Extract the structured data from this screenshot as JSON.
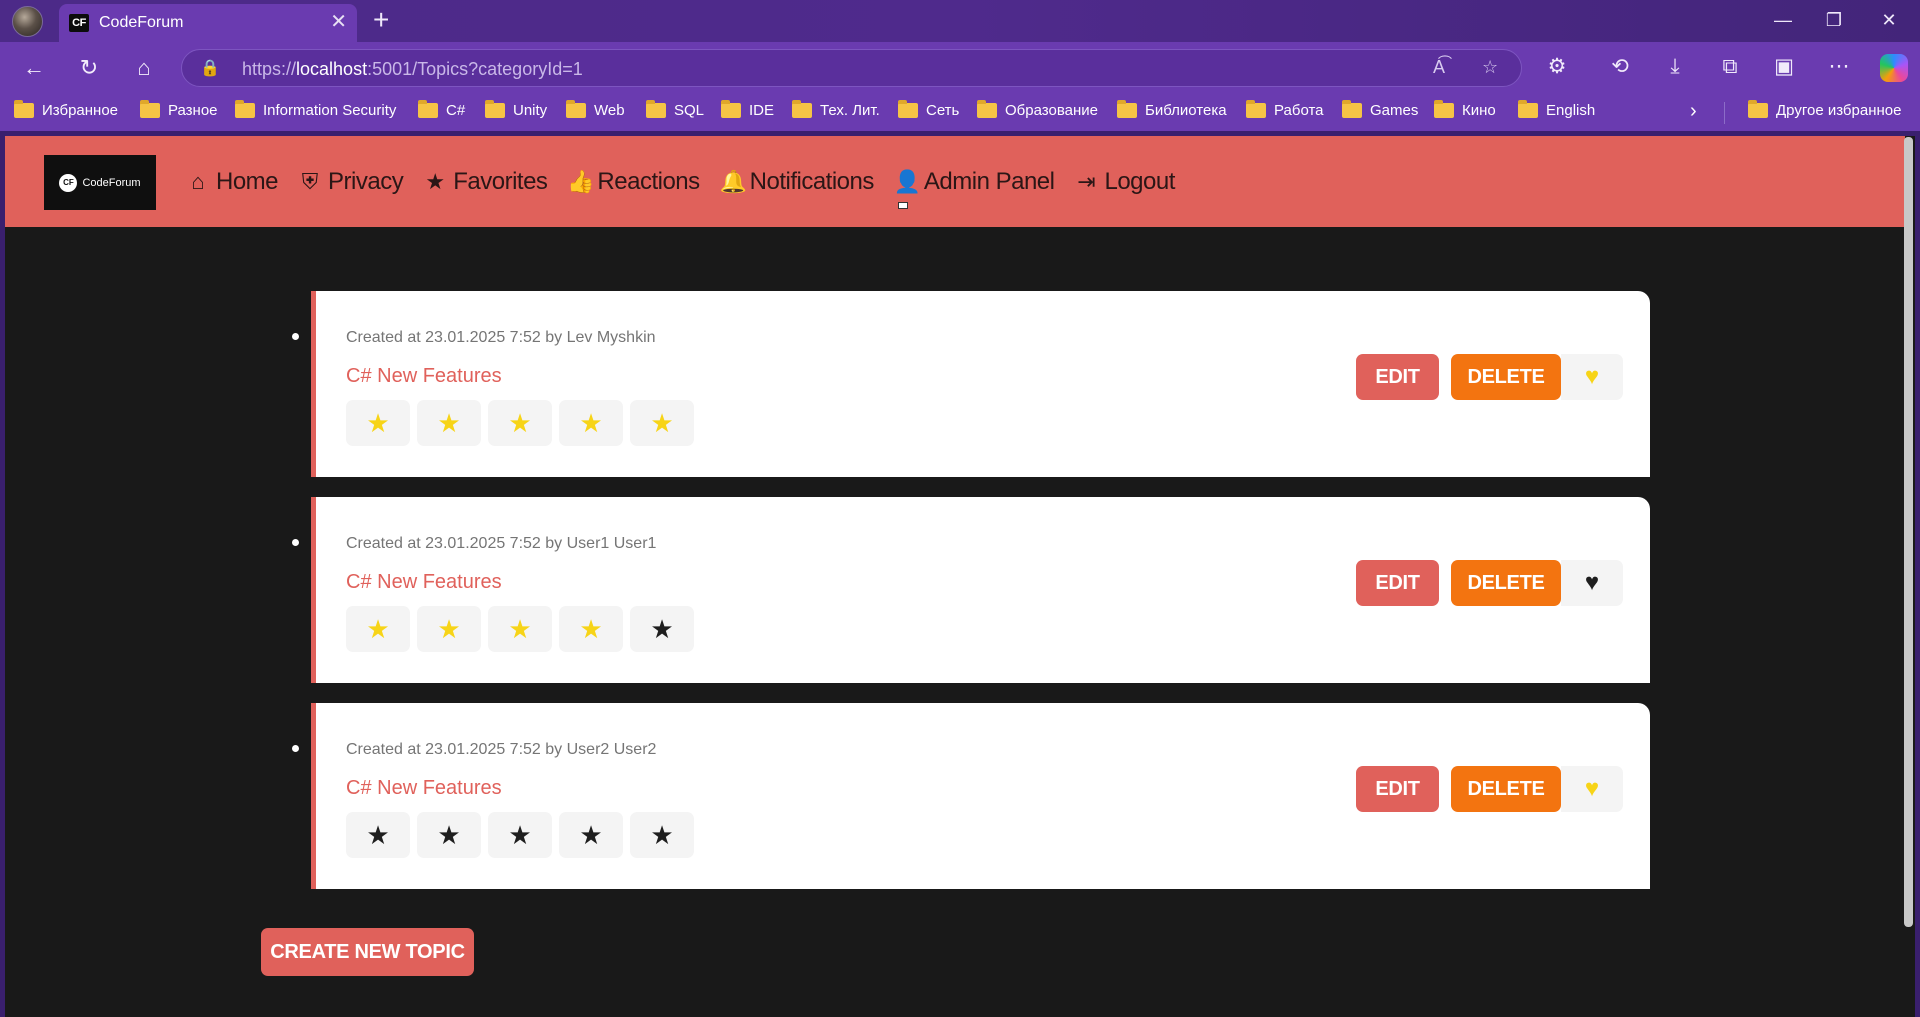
{
  "browser": {
    "tab_title": "CodeForum",
    "tab_favicon": "CF",
    "url_prefix": "https://",
    "url_host": "localhost",
    "url_rest": ":5001/Topics?categoryId=1",
    "bookmarks": [
      "Избранное",
      "Разное",
      "Information Security",
      "C#",
      "Unity",
      "Web",
      "SQL",
      "IDE",
      "Тех. Лит.",
      "Сеть",
      "Образование",
      "Библиотека",
      "Работа",
      "Games",
      "Кино",
      "English"
    ],
    "other_bookmarks": "Другое избранное",
    "accent": "#6a3bb0"
  },
  "site": {
    "logo_badge": "CF",
    "logo_text": "CodeForum",
    "menu": [
      "Home",
      "Privacy",
      "Favorites",
      "Reactions",
      "Notifications",
      "Admin Panel",
      "Logout"
    ],
    "nav_color": "#e0615b"
  },
  "topics": [
    {
      "meta": "Created at 23.01.2025 7:52 by Lev Myshkin",
      "title": "C# New Features",
      "rating": 5,
      "favorite": true,
      "edit": "EDIT",
      "delete": "DELETE"
    },
    {
      "meta": "Created at 23.01.2025 7:52 by User1 User1",
      "title": "C# New Features",
      "rating": 4,
      "favorite": false,
      "edit": "EDIT",
      "delete": "DELETE"
    },
    {
      "meta": "Created at 23.01.2025 7:52 by User2 User2",
      "title": "C# New Features",
      "rating": 0,
      "favorite": true,
      "edit": "EDIT",
      "delete": "DELETE"
    }
  ],
  "create_button": "CREATE NEW TOPIC",
  "colors": {
    "star_on": "#f7d417",
    "star_off": "#1e1e1e",
    "delete": "#f37410",
    "edit": "#e0615b"
  }
}
